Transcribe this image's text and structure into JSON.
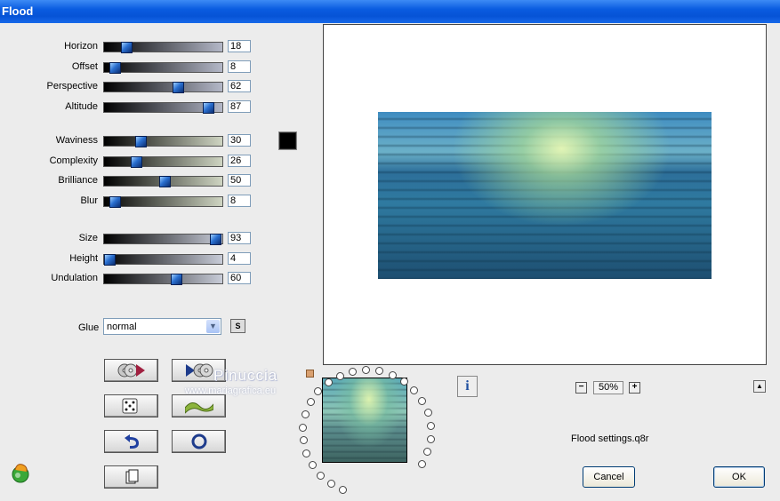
{
  "window": {
    "title": "Flood"
  },
  "groups": [
    {
      "rows": [
        {
          "name": "horizon",
          "label": "Horizon",
          "value": "18",
          "fraction": 0.18,
          "style": "g1"
        },
        {
          "name": "offset",
          "label": "Offset",
          "value": "8",
          "fraction": 0.08,
          "style": "g1"
        },
        {
          "name": "perspective",
          "label": "Perspective",
          "value": "62",
          "fraction": 0.62,
          "style": "g1"
        },
        {
          "name": "altitude",
          "label": "Altitude",
          "value": "87",
          "fraction": 0.87,
          "style": "g1"
        }
      ]
    },
    {
      "rows": [
        {
          "name": "waviness",
          "label": "Waviness",
          "value": "30",
          "fraction": 0.3,
          "style": "g2"
        },
        {
          "name": "complexity",
          "label": "Complexity",
          "value": "26",
          "fraction": 0.26,
          "style": "g2"
        },
        {
          "name": "brilliance",
          "label": "Brilliance",
          "value": "50",
          "fraction": 0.5,
          "style": "g2"
        },
        {
          "name": "blur",
          "label": "Blur",
          "value": "8",
          "fraction": 0.08,
          "style": "g2"
        }
      ]
    },
    {
      "rows": [
        {
          "name": "size",
          "label": "Size",
          "value": "93",
          "fraction": 0.93,
          "style": "g3"
        },
        {
          "name": "height",
          "label": "Height",
          "value": "4",
          "fraction": 0.04,
          "style": "g3"
        },
        {
          "name": "undulation",
          "label": "Undulation",
          "value": "60",
          "fraction": 0.6,
          "style": "g3"
        }
      ]
    }
  ],
  "color_swatch": "#000000",
  "glue": {
    "label": "Glue",
    "value": "normal",
    "s_button": "S"
  },
  "watermark": {
    "line1": "Pinuccia",
    "line2": "www.mariagrafica.eu"
  },
  "zoom": {
    "value": "50%",
    "minus": "−",
    "plus": "+"
  },
  "info_label": "i",
  "up_label": "▲",
  "settings_file": "Flood settings.q8r",
  "buttons": {
    "cancel": "Cancel",
    "ok": "OK"
  }
}
